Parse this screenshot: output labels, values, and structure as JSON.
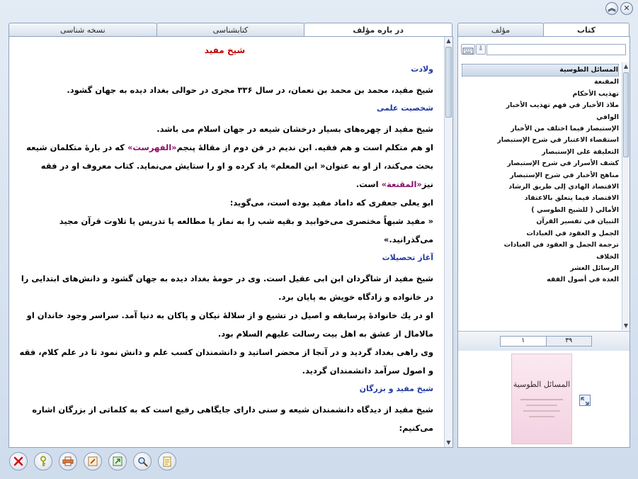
{
  "window": {
    "minimize_icon": "chevron-up-icon",
    "close_icon": "close-icon",
    "minimize_glyph": "︽",
    "close_glyph": "✕"
  },
  "left_tabs": [
    {
      "label": "در باره مؤلف",
      "active": true
    },
    {
      "label": "کتابشناسی",
      "active": false
    },
    {
      "label": "نسخه شناسی",
      "active": false
    }
  ],
  "right_tabs": [
    {
      "label": "کتاب",
      "active": true
    },
    {
      "label": "مؤلف",
      "active": false
    }
  ],
  "content": {
    "title": "شیخ مفید",
    "h_birth": "ولادت",
    "p_birth": "شیخ مفید، محمد بن محمد بن نعمان، در سال ۳۳۶ مجری در حوالی بغداد دیده به جهان گشود.",
    "h_personality": "شخصیت علمی",
    "p_personality_1": "شیخ مفید از چهره‌های بسیار درخشان شیعه در جهان اسلام می باشد.",
    "p_personality_2a": "او هم متکلم است و هم فقیه. ابن ندیم در فن دوم از مقالهٔ پنجم",
    "p_personality_2_hl": "«الفهرست»",
    "p_personality_2b": " که در بارهٔ متکلمان شیعه بحث می‌کند، از او به عنوان« ابن المعلم» یاد کرده و او را ستایش می‌نماید. کتاب معروف او در فقه نیز",
    "p_personality_2_hl2": "«المقنعة»",
    "p_personality_2c": " است.",
    "p_personality_3": "ابو یعلی جعفری که داماد مفید بوده است، می‌گوید:",
    "p_personality_4": "« مفید شبهاً مختصری می‌خوابید و بقیه شب را به نماز یا مطالعه یا تدریس یا تلاوت قرآن مجید می‌گذرانید.»",
    "h_education": "آغاز تحصیلات",
    "p_education_1": "شیخ مفید از شاگردان ابن ابی عقیل است. وی در حومهٔ بغداد دیده به جهان گشود و دانش‌های ابتدایی را در خانواده و زادگاه خویش به پایان برد.",
    "p_education_2": "او در یك خانوادهٔ پرسابقه و اصیل در تشیع و از سلالهٔ نیکان و پاکان به دنیا آمد. سراسر وجود خاندان او مالامال از عشق به اهل بیت رسالت علیهم السلام بود.",
    "p_education_3": "وی راهی بغداد گردید و در آنجا از محضر اساتید و دانشمندان کسب علم و دانش نمود تا در علم کلام، فقه و اصول سرآمد دانشمندان گردید.",
    "h_scholars": "شیخ مفید و بزرگان",
    "p_scholars_1": "شیخ مفید از دیدگاه دانشمندان شیعه و سنی دارای جایگاهی رفیع است که به کلماتی از بزرگان اشاره می‌کنیم:"
  },
  "search": {
    "placeholder": "",
    "value": "",
    "keyboard_icon": "keyboard-icon",
    "down_icon": "arrow-down-icon"
  },
  "books": [
    "المسائل الطوسية",
    "المقنعة",
    "تهذيب الأحكام",
    "ملاذ الأخبار في فهم تهذيب الأخبار",
    "الوافي",
    "الإستبصار فيما اختلف من الأخبار",
    "استقصاء الاعتبار في شرح الإستبصار",
    "التعليقة على الإستبصار",
    "كشف الأسرار في شرح الإستبصار",
    "مناهج الأخبار في شرح الإستبصار",
    "الاقتصاد الهادي إلى طريق الرشاد",
    "الاقتصاد فيما يتعلق بالاعتقاد",
    "الأمالي ( للشيخ الطوسي )",
    "التبيان في تفسير القرآن",
    "الجمل و العقود في العبادات",
    "ترجمة الجمل و العقود في العبادات",
    "الخلاف",
    "الرسائل العشر",
    "العدة في أصول الفقه"
  ],
  "pager": {
    "total": "۳۹",
    "current": "۱"
  },
  "cover": {
    "calligraphy": "المسائل الطوسية",
    "expand_icon": "expand-icon"
  },
  "toolbar": [
    {
      "name": "close-book-button",
      "icon": "red-x-icon"
    },
    {
      "name": "key-button",
      "icon": "key-icon"
    },
    {
      "name": "print-button",
      "icon": "printer-icon"
    },
    {
      "name": "edit-button",
      "icon": "pencil-icon"
    },
    {
      "name": "export-button",
      "icon": "export-icon"
    },
    {
      "name": "search-button",
      "icon": "magnifier-icon"
    },
    {
      "name": "notes-button",
      "icon": "notepad-icon"
    }
  ],
  "colors": {
    "heading": "#1f3aa0",
    "title": "#c00000",
    "highlight": "#8b0f6b",
    "border": "#8fa3bd"
  }
}
